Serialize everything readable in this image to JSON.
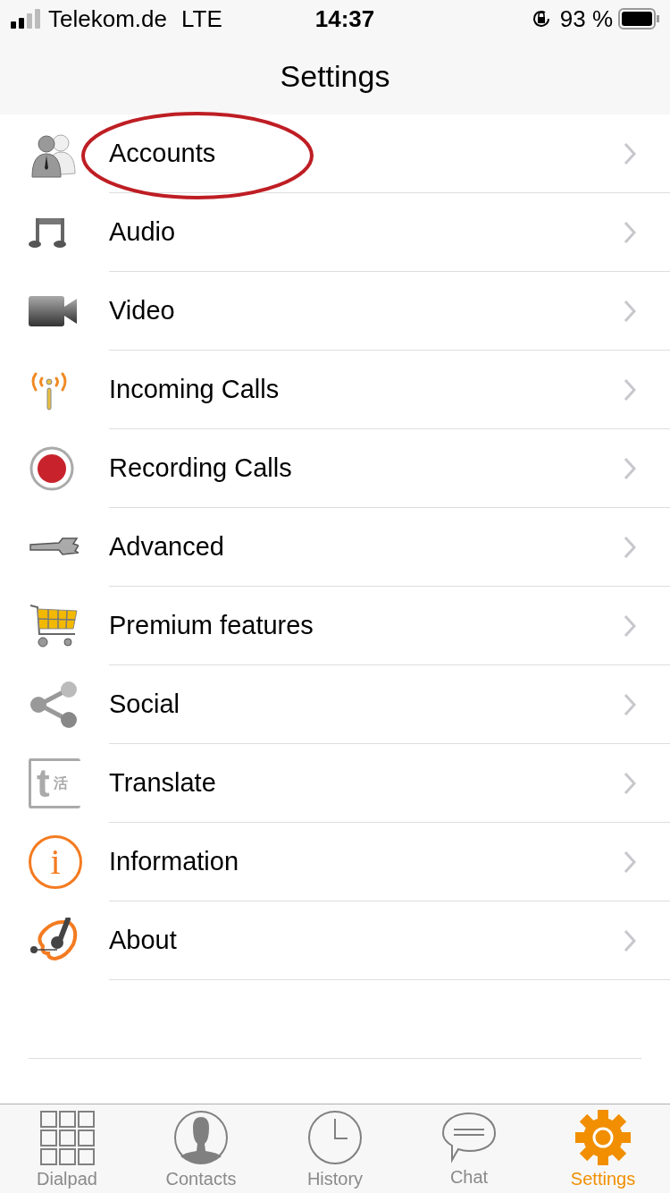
{
  "status_bar": {
    "carrier": "Telekom.de",
    "network": "LTE",
    "time": "14:37",
    "battery": "93 %"
  },
  "nav": {
    "title": "Settings"
  },
  "items": [
    {
      "kind": "accounts",
      "label": "Accounts",
      "highlighted": true
    },
    {
      "kind": "audio",
      "label": "Audio",
      "highlighted": false
    },
    {
      "kind": "video",
      "label": "Video",
      "highlighted": false
    },
    {
      "kind": "incoming",
      "label": "Incoming Calls",
      "highlighted": false
    },
    {
      "kind": "recording",
      "label": "Recording Calls",
      "highlighted": false
    },
    {
      "kind": "advanced",
      "label": "Advanced",
      "highlighted": false
    },
    {
      "kind": "premium",
      "label": "Premium features",
      "highlighted": false
    },
    {
      "kind": "social",
      "label": "Social",
      "highlighted": false
    },
    {
      "kind": "translate",
      "label": "Translate",
      "highlighted": false,
      "icon_glyphs": [
        "t",
        "活"
      ]
    },
    {
      "kind": "information",
      "label": "Information",
      "highlighted": false,
      "icon_glyphs": [
        "i"
      ]
    },
    {
      "kind": "about",
      "label": "About",
      "highlighted": false
    }
  ],
  "tabs": [
    {
      "kind": "dialpad",
      "label": "Dialpad",
      "selected": false
    },
    {
      "kind": "contacts",
      "label": "Contacts",
      "selected": false
    },
    {
      "kind": "history",
      "label": "History",
      "selected": false
    },
    {
      "kind": "chat",
      "label": "Chat",
      "selected": false
    },
    {
      "kind": "settings",
      "label": "Settings",
      "selected": true
    }
  ]
}
